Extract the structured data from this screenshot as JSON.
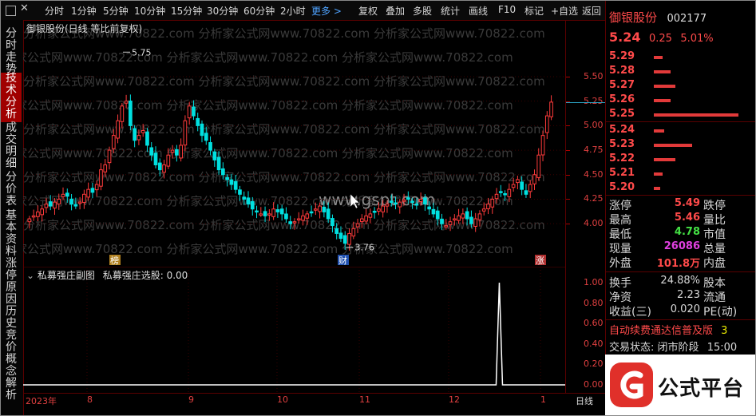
{
  "toolbar": {
    "items": [
      {
        "label": "分时"
      },
      {
        "label": "1分钟"
      },
      {
        "label": "5分钟"
      },
      {
        "label": "10分钟"
      },
      {
        "label": "15分钟"
      },
      {
        "label": "30分钟"
      },
      {
        "label": "60分钟"
      },
      {
        "label": "2小时"
      },
      {
        "label": "更多 >"
      },
      {
        "label": "复权"
      },
      {
        "label": "叠加"
      },
      {
        "label": "多股"
      },
      {
        "label": "统计"
      },
      {
        "label": "画线"
      },
      {
        "label": "F10"
      },
      {
        "label": "标记"
      },
      {
        "label": "+自选"
      },
      {
        "label": "返回"
      }
    ]
  },
  "sidebar": {
    "tabs": [
      {
        "label": "分时走势"
      },
      {
        "label": "技术分析",
        "active": true
      },
      {
        "label": "成交明细"
      },
      {
        "label": "分价表"
      },
      {
        "label": "基本资料"
      },
      {
        "label": "涨停原因"
      },
      {
        "label": "历史竞价"
      },
      {
        "label": "概念解析"
      }
    ]
  },
  "main_chart": {
    "title": "御银股份(日线 等比前复权)",
    "watermark": "分析家公式网www.70822.com",
    "center_watermark": "www.gspt.com",
    "high_label": "5.75",
    "low_label": "3.76",
    "markers": [
      "榜",
      "财",
      "涨"
    ],
    "axis_labels": [
      "5.50",
      "5.25",
      "5.00",
      "4.75",
      "4.50",
      "4.25",
      "4.00"
    ]
  },
  "sub_chart": {
    "title": "私募强庄副图",
    "indicator": "私募强庄选股: 0.00",
    "axis_labels": [
      "1.00",
      "0.80",
      "0.60",
      "0.40",
      "0.20",
      "0.00"
    ]
  },
  "dates": {
    "labels": [
      "2023年",
      "8",
      "9",
      "10",
      "11",
      "12",
      "1"
    ],
    "tail": "日线"
  },
  "panel": {
    "stock_name": "御银股份",
    "stock_code": "002177",
    "price": "5.24",
    "change": "0.25",
    "change_pct": "5.01%",
    "sell_book": [
      {
        "price": "5.29",
        "size": 0.1
      },
      {
        "price": "5.28",
        "size": 0.2
      },
      {
        "price": "5.27",
        "size": 0.25
      },
      {
        "price": "5.26",
        "size": 0.2
      },
      {
        "price": "5.25",
        "size": 1.0
      }
    ],
    "buy_book": [
      {
        "price": "5.24",
        "size": 0.12
      },
      {
        "price": "5.23",
        "size": 0.45
      },
      {
        "price": "5.22",
        "size": 0.25
      },
      {
        "price": "5.21",
        "size": 0.1
      },
      {
        "price": "5.20",
        "size": 0.08
      }
    ],
    "stats": [
      {
        "k1": "涨停",
        "v1": "5.49",
        "k2": "跌停",
        "c1": "red"
      },
      {
        "k1": "最高",
        "v1": "5.46",
        "k2": "量比",
        "c1": "red"
      },
      {
        "k1": "最低",
        "v1": "4.78",
        "k2": "市值",
        "c1": "green"
      },
      {
        "k1": "现量",
        "v1": "26086",
        "k2": "总量",
        "c1": "magenta"
      },
      {
        "k1": "外盘",
        "v1": "101.8万",
        "k2": "内盘",
        "c1": "red"
      }
    ],
    "stats2": [
      {
        "k1": "换手",
        "v1": "24.88%",
        "k2": "股本"
      },
      {
        "k1": "净资",
        "v1": "2.23",
        "k2": "流通"
      },
      {
        "k1": "收益(三)",
        "v1": "0.020",
        "k2": "PE(动)"
      }
    ],
    "notice": "自动续费通达信普及版",
    "notice_suffix": "3",
    "status_label": "交易状态:",
    "status_value": "闭市阶段",
    "status_time": "15:00"
  },
  "logo": {
    "text": "公式平台",
    "icon": "gspt-logo-icon"
  },
  "colors": {
    "up": "#ff3b3b",
    "down": "#00e0e0",
    "bg": "#000000",
    "grid": "#5a0000"
  },
  "chart_data": {
    "type": "candlestick",
    "title": "御银股份(日线 等比前复权)",
    "ylim": [
      3.7,
      5.85
    ],
    "high": 5.75,
    "low": 3.76,
    "x_labels": [
      "2023年",
      "8",
      "9",
      "10",
      "11",
      "12",
      "1"
    ],
    "closes": [
      4.05,
      4.08,
      4.12,
      4.15,
      4.2,
      4.18,
      4.22,
      4.25,
      4.3,
      4.28,
      4.2,
      4.18,
      4.22,
      4.3,
      4.35,
      4.32,
      4.4,
      4.55,
      4.6,
      4.75,
      4.9,
      5.05,
      5.2,
      5.25,
      5.0,
      4.85,
      4.9,
      4.95,
      4.8,
      4.7,
      4.6,
      4.55,
      4.6,
      4.7,
      4.75,
      4.7,
      4.8,
      5.05,
      5.2,
      5.1,
      5.0,
      4.9,
      4.85,
      4.75,
      4.65,
      4.55,
      4.5,
      4.45,
      4.4,
      4.35,
      4.3,
      4.25,
      4.2,
      4.15,
      4.12,
      4.1,
      4.08,
      4.1,
      4.15,
      4.12,
      4.1,
      4.05,
      4.0,
      4.02,
      4.05,
      4.08,
      4.1,
      4.12,
      4.15,
      4.18,
      4.12,
      4.05,
      3.98,
      3.9,
      3.85,
      3.8,
      3.9,
      3.95,
      4.0,
      4.05,
      4.08,
      4.1,
      4.12,
      4.15,
      4.18,
      4.2,
      4.22,
      4.2,
      4.22,
      4.24,
      4.25,
      4.22,
      4.2,
      4.25,
      4.2,
      4.15,
      4.1,
      4.05,
      4.0,
      3.98,
      4.02,
      4.05,
      4.08,
      4.1,
      4.05,
      4.0,
      4.05,
      4.1,
      4.15,
      4.2,
      4.25,
      4.3,
      4.32,
      4.3,
      4.35,
      4.4,
      4.45,
      4.35,
      4.3,
      4.4,
      4.5,
      4.7,
      4.9,
      5.1,
      5.24
    ],
    "sub_series": {
      "name": "私募强庄选股",
      "pulse_index": 112,
      "pulse_value": 1.0,
      "ylim": [
        0,
        1.1
      ]
    }
  }
}
